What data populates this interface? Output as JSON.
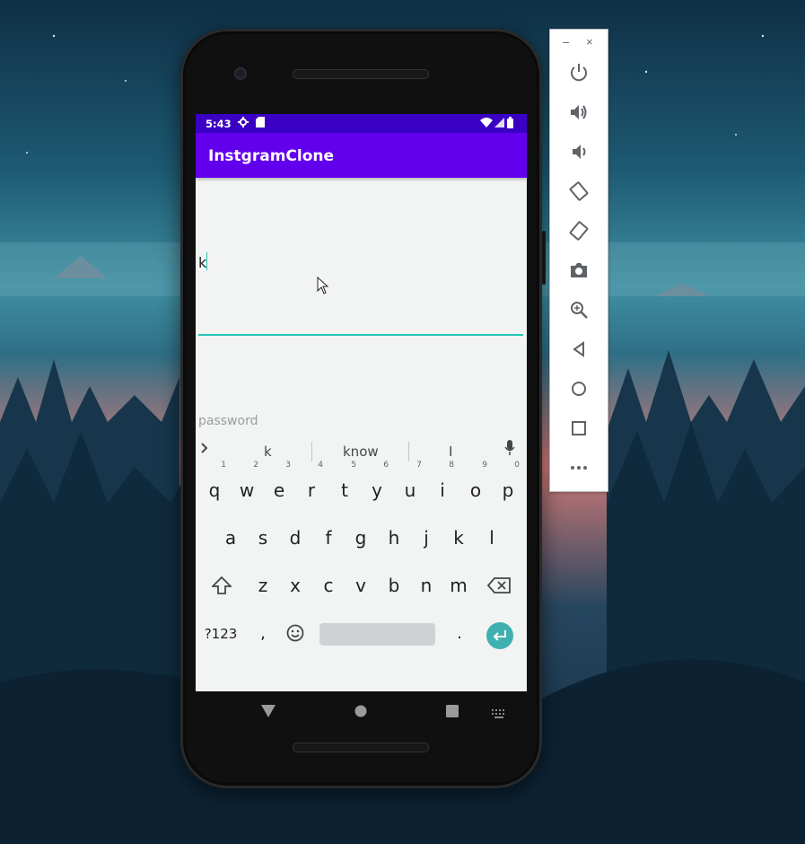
{
  "status_bar": {
    "time": "5:43",
    "icons": [
      "settings-gear-icon",
      "sd-card-icon",
      "wifi-icon",
      "signal-icon",
      "battery-icon"
    ]
  },
  "app_bar": {
    "title": "InstgramClone",
    "color": "#6200ee"
  },
  "form": {
    "username_value": "k",
    "password_placeholder": "password",
    "focus_underline_color": "#27c4b5"
  },
  "keyboard": {
    "suggestions": [
      "k",
      "know",
      "I"
    ],
    "row1": [
      {
        "key": "q",
        "hint": "1"
      },
      {
        "key": "w",
        "hint": "2"
      },
      {
        "key": "e",
        "hint": "3"
      },
      {
        "key": "r",
        "hint": "4"
      },
      {
        "key": "t",
        "hint": "5"
      },
      {
        "key": "y",
        "hint": "6"
      },
      {
        "key": "u",
        "hint": "7"
      },
      {
        "key": "i",
        "hint": "8"
      },
      {
        "key": "o",
        "hint": "9"
      },
      {
        "key": "p",
        "hint": "0"
      }
    ],
    "row2": [
      "a",
      "s",
      "d",
      "f",
      "g",
      "h",
      "j",
      "k",
      "l"
    ],
    "row3": [
      "z",
      "x",
      "c",
      "v",
      "b",
      "n",
      "m"
    ],
    "bottom": {
      "symbols_key": "?123",
      "comma": ",",
      "period": "."
    }
  },
  "nav_bar": {
    "icons": [
      "back-icon",
      "home-icon",
      "recents-icon",
      "keyboard-switch-icon"
    ]
  },
  "emulator_toolbar": {
    "window_controls": [
      "–",
      "×"
    ],
    "buttons": [
      "power-icon",
      "volume-up-icon",
      "volume-down-icon",
      "rotate-left-icon",
      "rotate-right-icon",
      "screenshot-icon",
      "zoom-icon",
      "back-icon",
      "home-icon",
      "overview-icon",
      "more-icon"
    ]
  }
}
